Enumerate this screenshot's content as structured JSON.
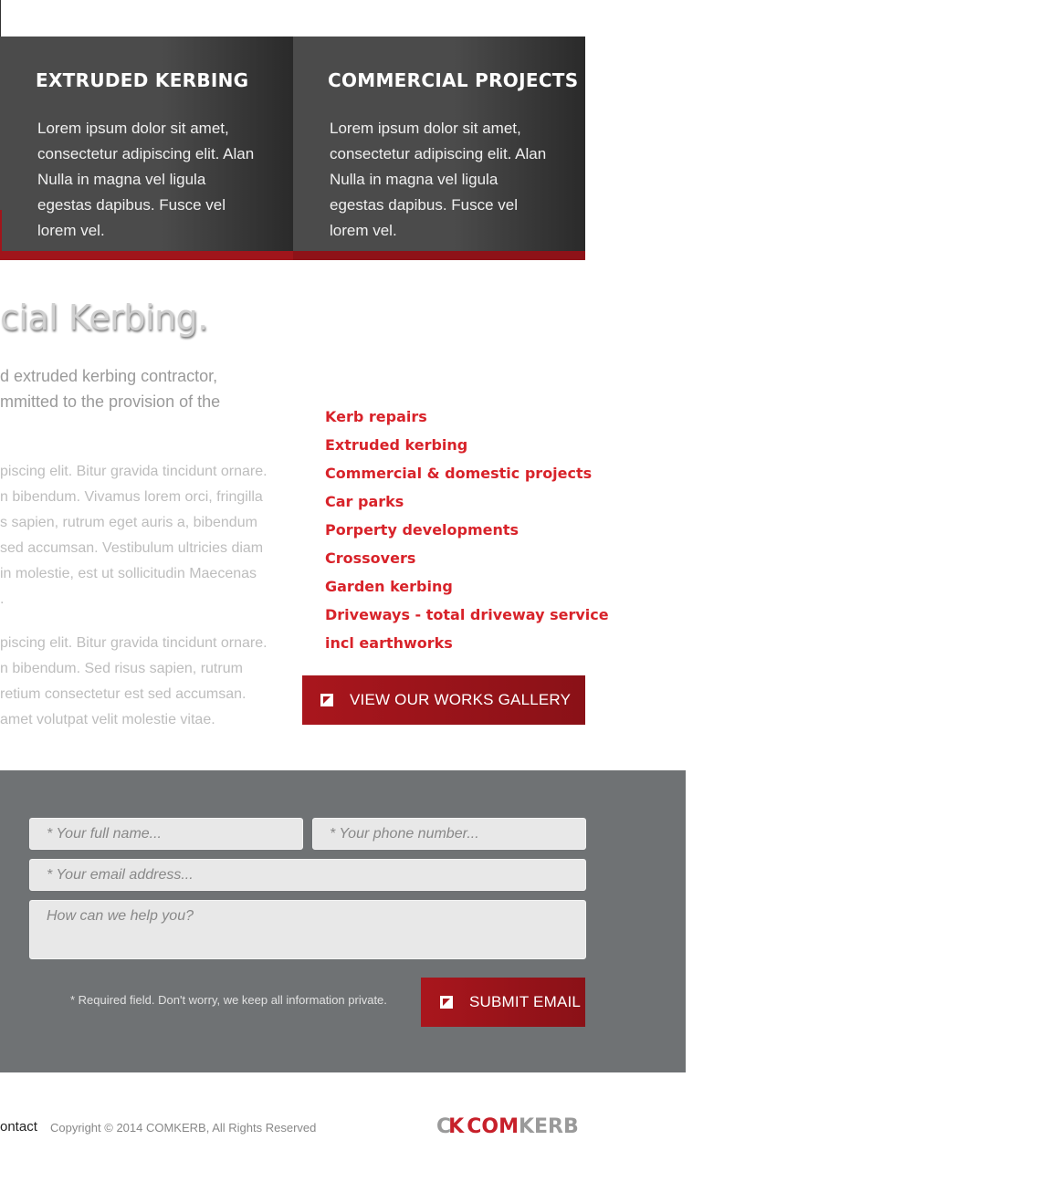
{
  "panels": [
    {
      "title": "EXTRUDED KERBING",
      "text": "Lorem ipsum dolor sit amet, consectetur adipiscing elit. Alan Nulla in magna vel ligula egestas dapibus. Fusce vel lorem vel."
    },
    {
      "title": "COMMERCIAL PROJECTS",
      "text": "Lorem ipsum dolor sit amet, consectetur adipiscing elit. Alan Nulla in magna vel ligula egestas dapibus. Fusce vel lorem vel."
    }
  ],
  "main": {
    "headline": "cial Kerbing.",
    "intro": "d extruded kerbing contractor,\nmmitted to the provision of the",
    "para1": "piscing elit. Bitur gravida tincidunt ornare.\nn bibendum. Vivamus lorem orci, fringilla\ns sapien, rutrum eget auris a, bibendum\nsed accumsan. Vestibulum ultricies diam\nin molestie, est ut sollicitudin Maecenas\n.",
    "para2": "piscing elit. Bitur gravida tincidunt ornare.\nn bibendum. Sed risus sapien, rutrum\nretium consectetur est sed accumsan.\namet volutpat velit molestie vitae."
  },
  "services": [
    "Kerb repairs",
    "Extruded kerbing",
    "Commercial & domestic projects",
    "Car parks",
    "Porperty developments",
    "Crossovers",
    "Garden kerbing",
    "Driveways - total driveway service",
    "incl earthworks"
  ],
  "gallery_button": "VIEW OUR WORKS GALLERY",
  "form": {
    "name_placeholder": "* Your full name...",
    "phone_placeholder": "* Your phone number...",
    "email_placeholder": "* Your email address...",
    "message_placeholder": "How can we help you?",
    "note": "* Required field.  Don't worry, we keep all information private.",
    "submit_label": "SUBMIT EMAIL"
  },
  "footer": {
    "link": "ontact",
    "copyright": "Copyright © 2014 COMKERB, All Rights Reserved",
    "logo_mark_c": "C",
    "logo_mark_k": "K",
    "logo_com": "COM",
    "logo_kerb": "KERB"
  },
  "colors": {
    "accent_red": "#a0151b",
    "service_red": "#d8232a",
    "panel_dark": "#4b4b4b",
    "form_bg": "#6f7274"
  },
  "icons": [
    "external-link-icon"
  ]
}
